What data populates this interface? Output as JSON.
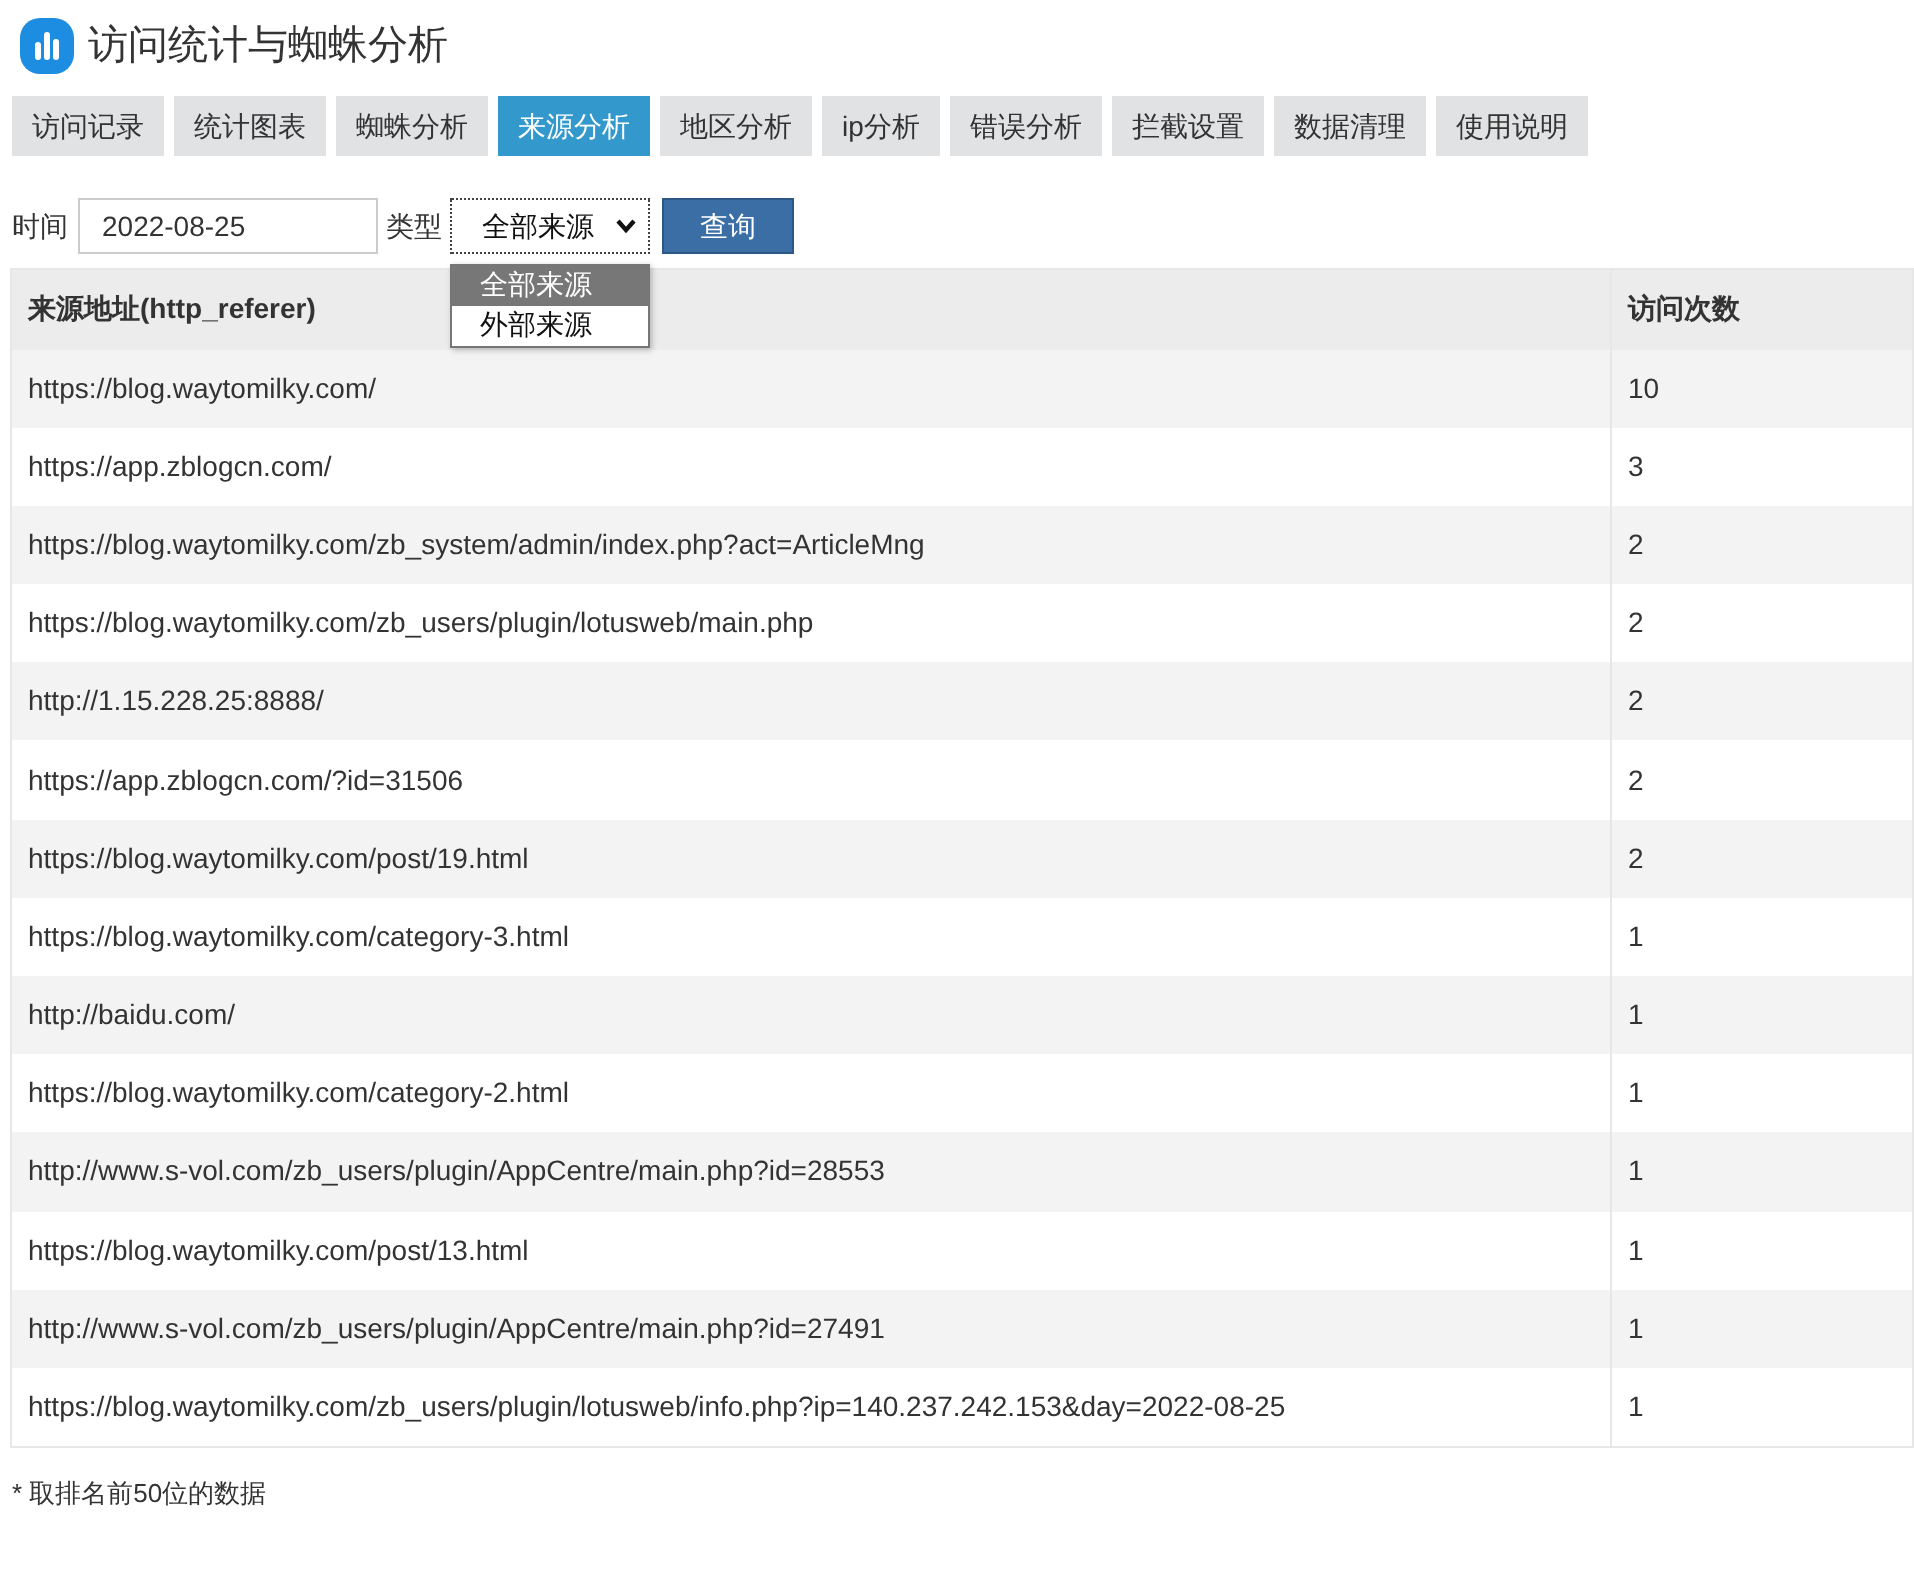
{
  "header": {
    "title": "访问统计与蜘蛛分析"
  },
  "tabs": [
    {
      "label": "访问记录",
      "selected": false
    },
    {
      "label": "统计图表",
      "selected": false
    },
    {
      "label": "蜘蛛分析",
      "selected": false
    },
    {
      "label": "来源分析",
      "selected": true
    },
    {
      "label": "地区分析",
      "selected": false
    },
    {
      "label": "ip分析",
      "selected": false
    },
    {
      "label": "错误分析",
      "selected": false
    },
    {
      "label": "拦截设置",
      "selected": false
    },
    {
      "label": "数据清理",
      "selected": false
    },
    {
      "label": "使用说明",
      "selected": false
    }
  ],
  "filter": {
    "date_label": "时间",
    "date_value": "2022-08-25",
    "type_label": "类型",
    "type_value": "全部来源",
    "type_expanded": true,
    "type_options": [
      {
        "label": "全部来源",
        "selected": true
      },
      {
        "label": "外部来源",
        "selected": false
      }
    ],
    "query_button": "查询"
  },
  "table": {
    "columns": [
      "来源地址(http_referer)",
      "访问次数"
    ],
    "rows": [
      [
        "https://blog.waytomilky.com/",
        "10"
      ],
      [
        "https://app.zblogcn.com/",
        "3"
      ],
      [
        "https://blog.waytomilky.com/zb_system/admin/index.php?act=ArticleMng",
        "2"
      ],
      [
        "https://blog.waytomilky.com/zb_users/plugin/lotusweb/main.php",
        "2"
      ],
      [
        "http://1.15.228.25:8888/",
        "2"
      ],
      [
        "https://app.zblogcn.com/?id=31506",
        "2"
      ],
      [
        "https://blog.waytomilky.com/post/19.html",
        "2"
      ],
      [
        "https://blog.waytomilky.com/category-3.html",
        "1"
      ],
      [
        "http://baidu.com/",
        "1"
      ],
      [
        "https://blog.waytomilky.com/category-2.html",
        "1"
      ],
      [
        "http://www.s-vol.com/zb_users/plugin/AppCentre/main.php?id=28553",
        "1"
      ],
      [
        "https://blog.waytomilky.com/post/13.html",
        "1"
      ],
      [
        "http://www.s-vol.com/zb_users/plugin/AppCentre/main.php?id=27491",
        "1"
      ],
      [
        "https://blog.waytomilky.com/zb_users/plugin/lotusweb/info.php?ip=140.237.242.153&day=2022-08-25",
        "1"
      ]
    ]
  },
  "footnote": "* 取排名前50位的数据"
}
